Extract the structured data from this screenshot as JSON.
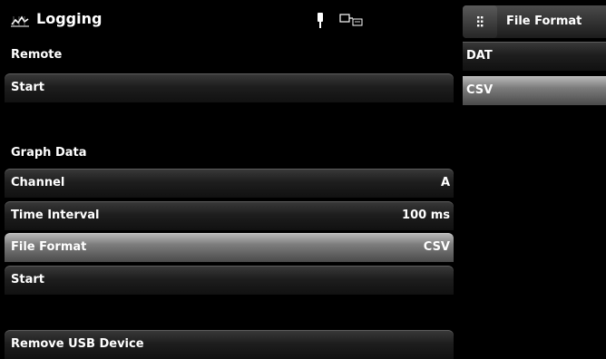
{
  "header": {
    "title": "Logging",
    "app_icon": "logging-graph-icon",
    "status_icons": [
      "usb-icon",
      "remote-connection-icon"
    ]
  },
  "remote": {
    "section_label": "Remote",
    "start_label": "Start"
  },
  "graph_data": {
    "section_label": "Graph Data",
    "rows": [
      {
        "label": "Channel",
        "value": "A"
      },
      {
        "label": "Time Interval",
        "value": "100 ms"
      },
      {
        "label": "File Format",
        "value": "CSV",
        "selected": true
      },
      {
        "label": "Start",
        "value": ""
      }
    ]
  },
  "remove_usb_label": "Remove USB Device",
  "file_format_panel": {
    "title": "File Format",
    "menu_icon": "grid-menu-icon",
    "options": [
      {
        "label": "DAT",
        "selected": false
      },
      {
        "label": "CSV",
        "selected": true
      }
    ]
  },
  "colors": {
    "background": "#000000",
    "text": "#ffffff",
    "selected_row": "#8a8a8a"
  }
}
